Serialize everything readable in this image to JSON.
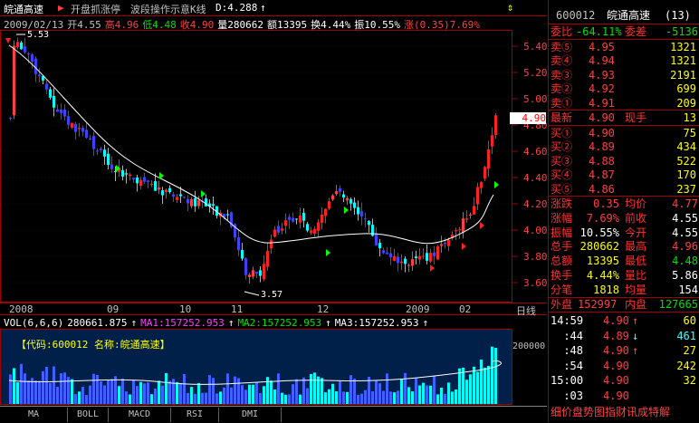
{
  "header": {
    "stock_name": "皖通高速",
    "indicator1": "开盘抓涨停",
    "indicator2": "波段操作示意K线",
    "d_value": "D:4.288",
    "date_label": "2009/02/13",
    "open": "开4.55",
    "high": "高4.96",
    "low": "低4.48",
    "close": "收4.90",
    "volume": "量280662",
    "amount": "额13395",
    "turnover": "换4.44%",
    "amplitude": "振10.55%",
    "change": "涨(0.35)7.69%"
  },
  "price_axis": [
    "5.40",
    "5.20",
    "5.00",
    "4.80",
    "4.60",
    "4.40",
    "4.20",
    "4.00",
    "3.80",
    "3.60"
  ],
  "current_price_tag": "4.90",
  "annotations": {
    "high": "5.53",
    "low": "3.57"
  },
  "x_axis": [
    "2008",
    "09",
    "10",
    "11",
    "12",
    "2009",
    "02"
  ],
  "day_line_label": "日线",
  "volume_header": {
    "vol_label": "VOL(6,6,6)",
    "vol_value": "280661.875",
    "ma1": "MA1:157252.953",
    "ma2": "MA2:157252.953",
    "ma3": "MA3:157252.953"
  },
  "volume_info": "【代码:600012 名称:皖通高速】",
  "volume_axis": "200000",
  "tabs": [
    "MA",
    "BOLL",
    "MACD",
    "RSI",
    "DMI"
  ],
  "panel": {
    "code": "600012",
    "name": "皖通高速",
    "count": "(13)",
    "weibi_label": "委比",
    "weibi": "-64.11%",
    "weicha_label": "委差",
    "weicha": "-5136",
    "sells": [
      {
        "label": "卖⑤",
        "price": "4.95",
        "vol": "1321"
      },
      {
        "label": "卖④",
        "price": "4.94",
        "vol": "1321"
      },
      {
        "label": "卖③",
        "price": "4.93",
        "vol": "2191"
      },
      {
        "label": "卖②",
        "price": "4.92",
        "vol": "699"
      },
      {
        "label": "卖①",
        "price": "4.91",
        "vol": "209"
      }
    ],
    "latest_label": "最新",
    "latest": "4.90",
    "xianshou_label": "现手",
    "xianshou": "13",
    "buys": [
      {
        "label": "买①",
        "price": "4.90",
        "vol": "75"
      },
      {
        "label": "买②",
        "price": "4.89",
        "vol": "434"
      },
      {
        "label": "买③",
        "price": "4.88",
        "vol": "522"
      },
      {
        "label": "买④",
        "price": "4.87",
        "vol": "170"
      },
      {
        "label": "买⑤",
        "price": "4.86",
        "vol": "237"
      }
    ],
    "stats": [
      {
        "l1": "涨跌",
        "v1": "0.35",
        "l2": "均价",
        "v2": "4.77"
      },
      {
        "l1": "涨幅",
        "v1": "7.69%",
        "l2": "前收",
        "v2": "4.55"
      },
      {
        "l1": "振幅",
        "v1": "10.55%",
        "l2": "今开",
        "v2": "4.55"
      },
      {
        "l1": "总手",
        "v1": "280662",
        "l2": "最高",
        "v2": "4.96"
      },
      {
        "l1": "总额",
        "v1": "13395",
        "l2": "最低",
        "v2": "4.48"
      },
      {
        "l1": "换手",
        "v1": "4.44%",
        "l2": "量比",
        "v2": "5.86"
      },
      {
        "l1": "分笔",
        "v1": "1818",
        "l2": "均量",
        "v2": "154"
      }
    ],
    "waipan_label": "外盘",
    "waipan": "152997",
    "neipan_label": "内盘",
    "neipan": "127665",
    "ticks": [
      {
        "time": "14:59",
        "price": "4.90",
        "arrow": "↑",
        "vol": "60"
      },
      {
        "time": ":44",
        "price": "4.89",
        "arrow": "↓",
        "vol": "461"
      },
      {
        "time": ":48",
        "price": "4.90",
        "arrow": "↑",
        "vol": "27"
      },
      {
        "time": ":54",
        "price": "4.90",
        "arrow": "",
        "vol": "242"
      },
      {
        "time": "15:00",
        "price": "4.90",
        "arrow": "",
        "vol": "32"
      },
      {
        "time": ":03",
        "price": "4.90",
        "arrow": "",
        "vol": ""
      }
    ],
    "footer": "细价盘势图指财讯成特解"
  }
}
